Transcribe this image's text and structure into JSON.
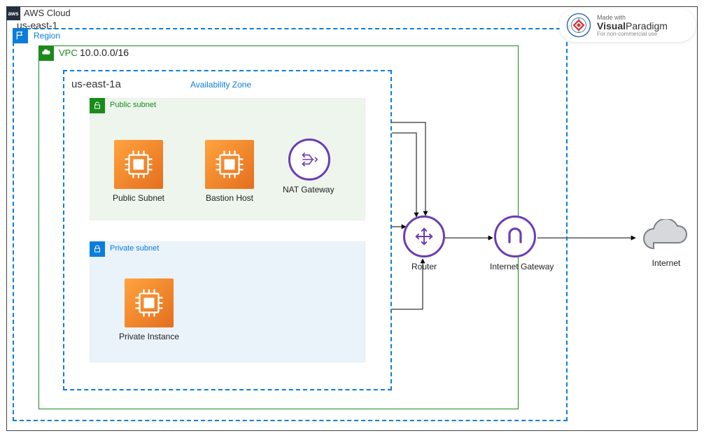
{
  "cloud": {
    "label": "AWS Cloud"
  },
  "region": {
    "name": "us-east-1",
    "label": "Region"
  },
  "vpc": {
    "label": "VPC",
    "cidr": "10.0.0.0/16"
  },
  "az": {
    "name": "us-east-1a",
    "label": "Availability Zone"
  },
  "public_subnet": {
    "label": "Public subnet"
  },
  "private_subnet": {
    "label": "Private subnet"
  },
  "nodes": {
    "public_instance": "Public Subnet",
    "bastion": "Bastion Host",
    "nat": "NAT Gateway",
    "private_instance": "Private Instance",
    "router": "Router",
    "igw": "Internet Gateway",
    "internet": "Internet"
  },
  "watermark": {
    "line1": "Made with",
    "line2a": "Visual",
    "line2b": "Paradigm",
    "line3": "For non-commercial use"
  },
  "colors": {
    "aws_dark": "#232f3e",
    "blue": "#0b7dda",
    "green": "#1a8a1a",
    "orange1": "#ffa33e",
    "orange2": "#e46f1e",
    "purple": "#6a3db5"
  }
}
